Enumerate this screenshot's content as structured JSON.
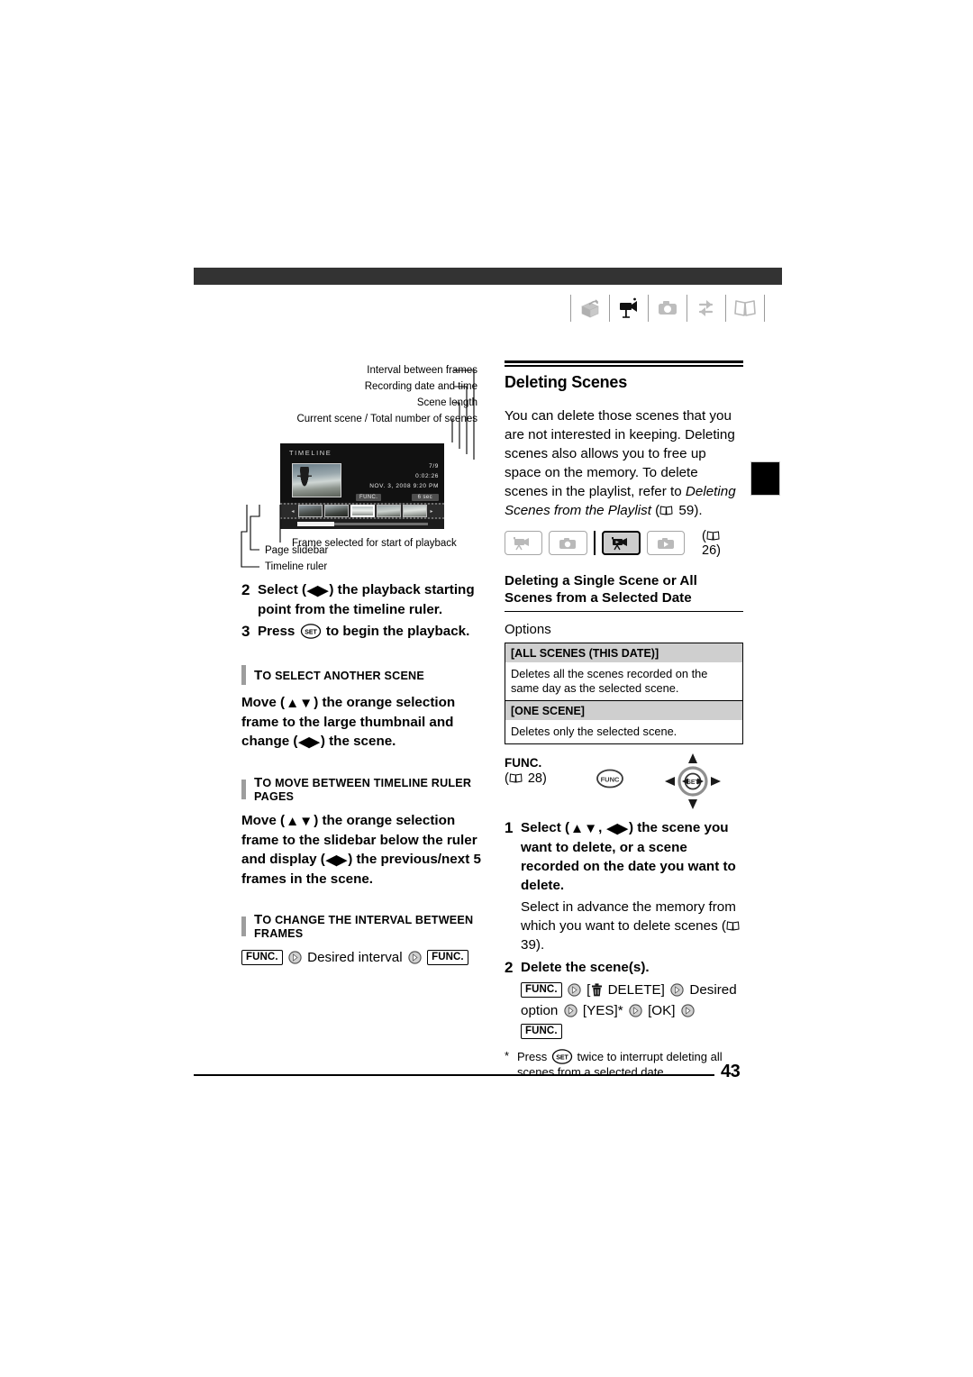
{
  "document": {
    "page_number": "43"
  },
  "header": {
    "icons": [
      "unpack-box-icon",
      "camcorder-icon",
      "photo-camera-icon",
      "transfer-arrows-icon",
      "open-book-icon"
    ],
    "active_icon_index": 1
  },
  "diagram": {
    "callouts_top": [
      "Interval between frames",
      "Recording date and time",
      "Scene length",
      "Current scene / Total number of scenes"
    ],
    "callouts_bottom": [
      "Frame selected for start of playback",
      "Page slidebar",
      "Timeline ruler"
    ],
    "screen": {
      "title": "TIMELINE",
      "scene_count": "7/9",
      "scene_length": "0:02:26",
      "record_date": "NOV.  3, 2008    9:20 PM",
      "func_label": "FUNC.",
      "interval_label": "6 sec",
      "left_arrow": "◂",
      "right_arrow": "▸",
      "selected_thumb_index": 2
    }
  },
  "left_column": {
    "step2": {
      "num": "2",
      "text_a": "Select (",
      "dirs": "◀▶",
      "text_b": ") the playback starting point from the timeline ruler."
    },
    "step3": {
      "num": "3",
      "text_a": "Press ",
      "set_label": "SET",
      "text_b": " to begin the playback."
    },
    "section1": {
      "heading_first": "T",
      "heading_rest": "O SELECT ANOTHER SCENE",
      "body_a": "Move (",
      "dirs_a": "▲▼",
      "body_b": ") the orange selection frame to the large thumbnail and change (",
      "dirs_b": "◀▶",
      "body_c": ") the scene."
    },
    "section2": {
      "heading_first": "T",
      "heading_rest": "O MOVE BETWEEN TIMELINE RULER PAGES",
      "body_a": "Move (",
      "dirs_a": "▲▼",
      "body_b": ") the orange selection frame to the slidebar below the ruler and display (",
      "dirs_b": "◀▶",
      "body_c": ") the previous/next 5 frames in the scene."
    },
    "section3": {
      "heading_first": "T",
      "heading_rest": "O CHANGE THE INTERVAL BETWEEN FRAMES",
      "func_1": "FUNC.",
      "middle": "Desired interval",
      "func_2": "FUNC."
    }
  },
  "right_column": {
    "title": "Deleting Scenes",
    "intro_a": "You can delete those scenes that you are not interested in keeping. Deleting scenes also allows you to free up space on the memory. To delete scenes in the playlist, refer to ",
    "intro_italic": "Deleting Scenes from the Playlist",
    "intro_ref": " 59).",
    "mode_buttons": [
      "movie-record-mode",
      "photo-record-mode",
      "movie-playback-mode",
      "photo-playback-mode"
    ],
    "active_mode_index": 2,
    "mode_page_ref": " 26)",
    "subtitle": "Deleting a Single Scene or All Scenes from a Selected Date",
    "options_label": "Options",
    "options": [
      {
        "name": "[ALL SCENES (THIS DATE)]",
        "description": "Deletes all the scenes recorded on the same day as the selected scene."
      },
      {
        "name": "[ONE SCENE]",
        "description": "Deletes only the selected scene."
      }
    ],
    "func_block": {
      "label": "FUNC.",
      "page_ref": " 28)",
      "round_button_label": "FUNC",
      "joystick_center_label": "SET"
    },
    "step1": {
      "num": "1",
      "text_a": "Select (",
      "dirs_a": "▲▼",
      "comma": ", ",
      "dirs_b": "◀▶",
      "text_b": ") the scene you want to delete, or a scene recorded on the date you want to delete.",
      "sub_text": "Select in advance the memory from which you want to delete scenes (",
      "sub_ref": " 39)."
    },
    "step2": {
      "num": "2",
      "title": "Delete the scene(s).",
      "func_1": "FUNC.",
      "delete_label": "DELETE]",
      "open_bracket": "[",
      "desired_option": "Desired option",
      "yes_label": "[YES]*",
      "ok_label": "[OK]",
      "func_2": "FUNC."
    },
    "footnote": {
      "star": "*",
      "text_a": "Press ",
      "set_label": "SET",
      "text_b": " twice to interrupt deleting all scenes from a selected date."
    }
  }
}
